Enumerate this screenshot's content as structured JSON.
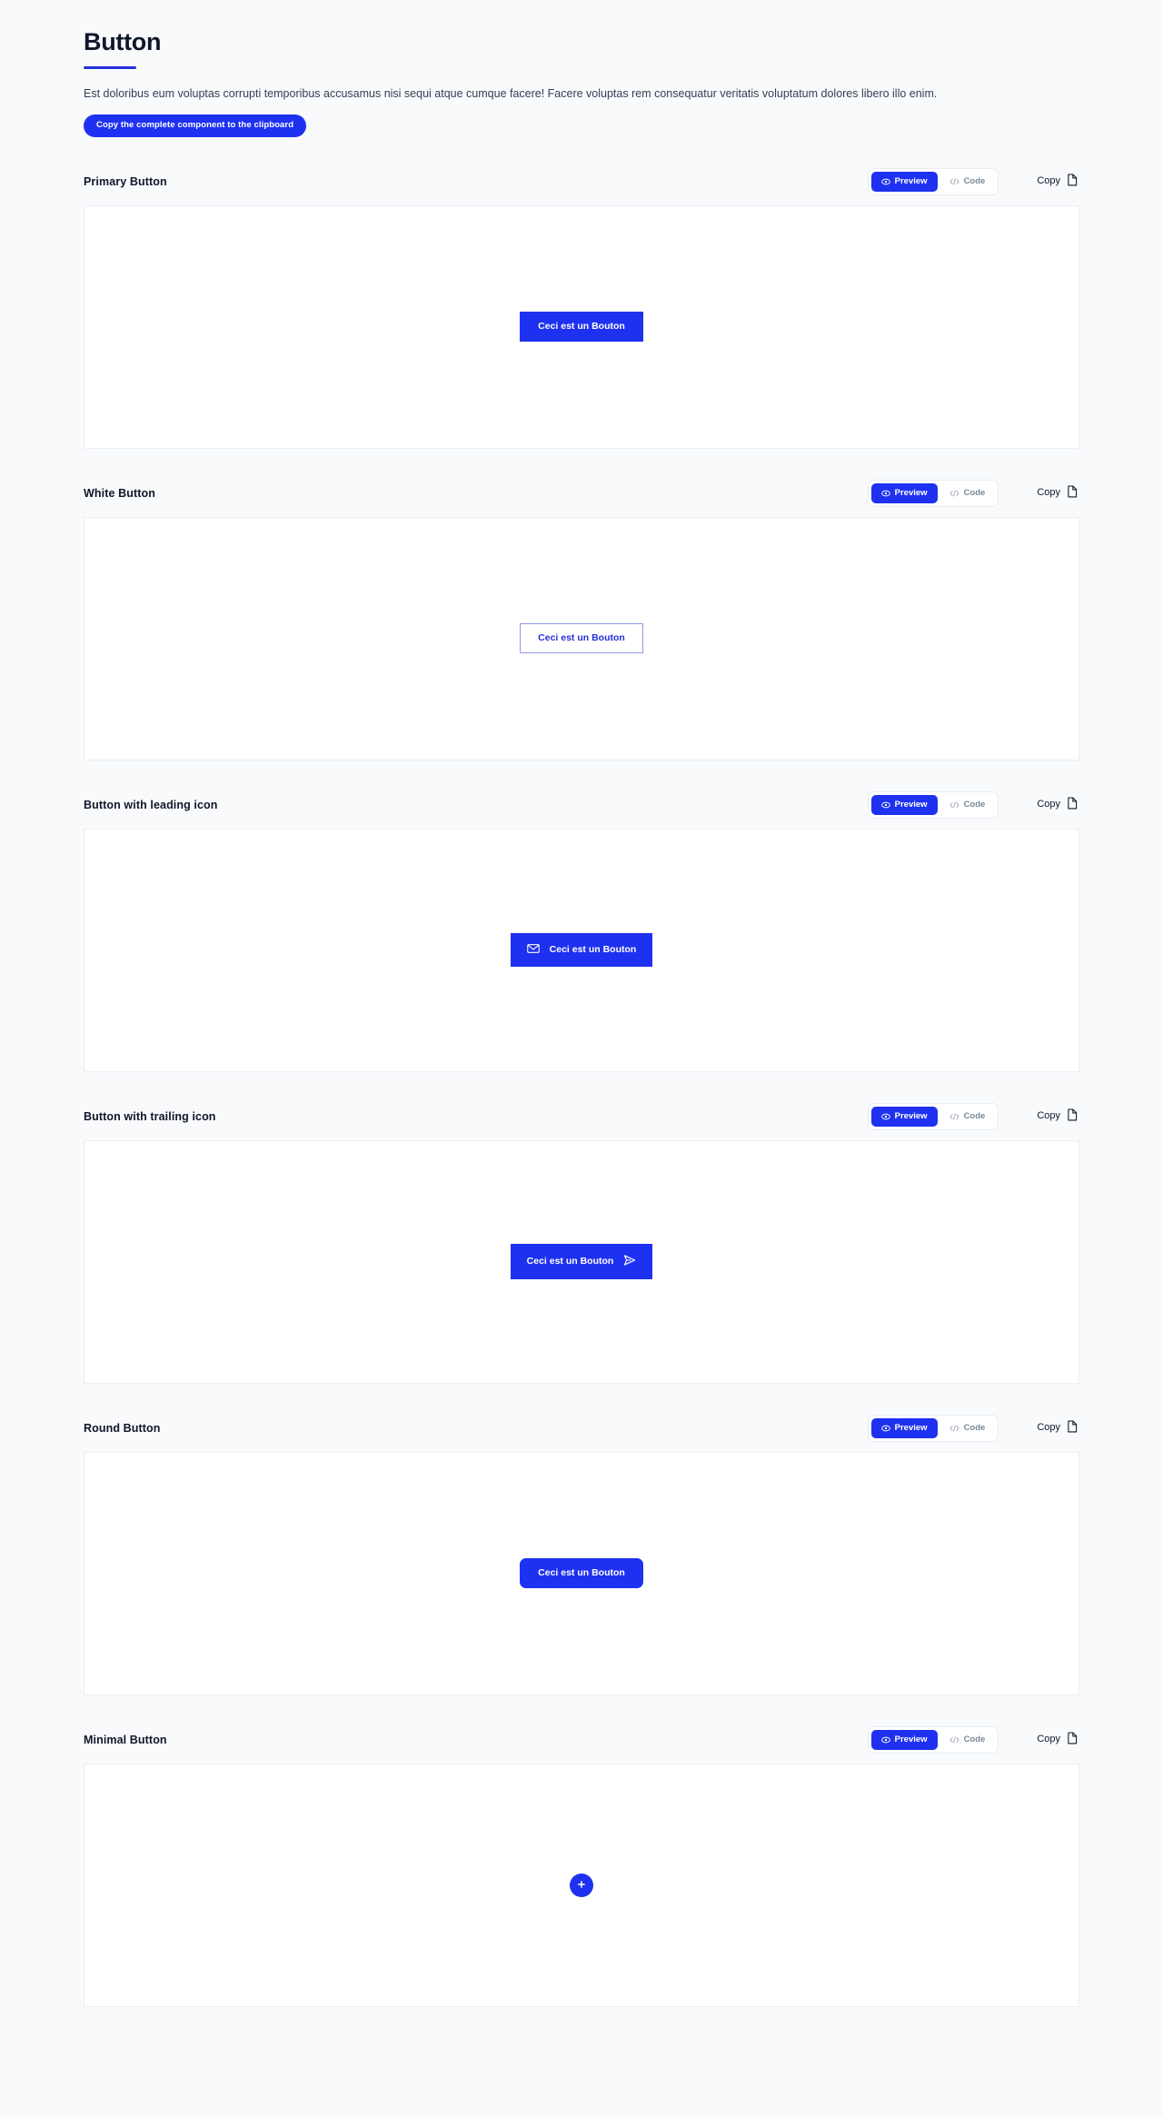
{
  "header": {
    "title": "Button",
    "description": "Est doloribus eum voluptas corrupti temporibus accusamus nisi sequi atque cumque facere! Facere voluptas rem consequatur veritatis voluptatum dolores libero illo enim.",
    "copy_all_label": "Copy the complete component to the clipboard"
  },
  "controls": {
    "preview_label": "Preview",
    "code_label": "Code",
    "copy_label": "Copy",
    "preview_icon": "eye-icon",
    "code_icon": "code-brackets-icon",
    "copy_icon": "document-icon",
    "active_tab": "Preview"
  },
  "colors": {
    "accent": "#1f31f0",
    "accent_dark": "#2430d8",
    "page_bg": "#f8fafc",
    "panel_bg": "#ffffff",
    "border": "#eceff4",
    "text": "#0f172a",
    "muted": "#7c8799"
  },
  "sections": [
    {
      "title": "Primary Button",
      "demo_label": "Ceci est un Bouton",
      "variant": "primary",
      "icon": null
    },
    {
      "title": "White Button",
      "demo_label": "Ceci est un Bouton",
      "variant": "white",
      "icon": null
    },
    {
      "title": "Button with leading icon",
      "demo_label": "Ceci est un Bouton",
      "variant": "leading-icon",
      "icon": "mail-icon"
    },
    {
      "title": "Button with trailing icon",
      "demo_label": "Ceci est un Bouton",
      "variant": "trailing-icon",
      "icon": "send-icon"
    },
    {
      "title": "Round Button",
      "demo_label": "Ceci est un Bouton",
      "variant": "round",
      "icon": null
    },
    {
      "title": "Minimal Button",
      "demo_label": "",
      "variant": "minimal",
      "icon": "plus-icon"
    }
  ]
}
